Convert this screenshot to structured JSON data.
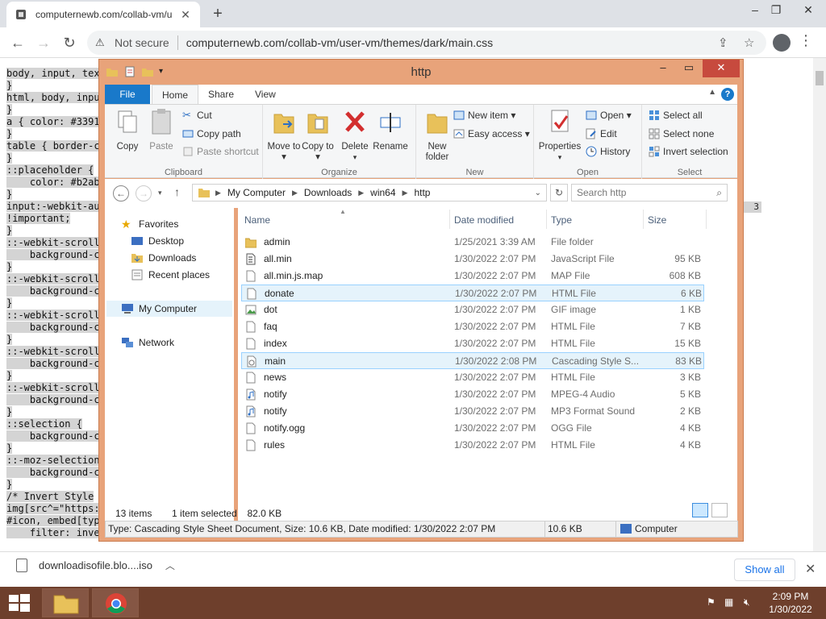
{
  "browser": {
    "tab_title": "computernewb.com/collab-vm/u",
    "tab_close": "✕",
    "new_tab": "+",
    "url_security": "Not secure",
    "url": "computernewb.com/collab-vm/user-vm/themes/dark/main.css",
    "minimize": "–",
    "restore": "❐",
    "close": "✕"
  },
  "page_text_lines": [
    "body, input, tex",
    "}",
    "html, body, inpu",
    "}",
    "a { color: #3391",
    "}",
    "table { border-c",
    "}",
    "::placeholder {",
    "    color: #b2ab",
    "}",
    "input:-webkit-au",
    "!important;",
    "}",
    "::-webkit-scroll",
    "    background-c",
    "}",
    "::-webkit-scroll",
    "    background-c",
    "}",
    "::-webkit-scroll",
    "    background-c",
    "}",
    "::-webkit-scroll",
    "    background-c",
    "}",
    "::-webkit-scroll",
    "    background-c",
    "}",
    "::selection {",
    "    background-c",
    "}",
    "::-moz-selection",
    "    background-c",
    "}",
    "/* Invert Style",
    "img[src^=\"https:",
    "#icon, embed[typ",
    "    filter: inve"
  ],
  "page_stray": "3",
  "explorer": {
    "title": "http",
    "tabs": [
      "File",
      "Home",
      "Share",
      "View"
    ],
    "help": "?",
    "ribbon": {
      "clipboard": {
        "name": "Clipboard",
        "copy": "Copy",
        "paste": "Paste",
        "cut": "Cut",
        "copy_path": "Copy path",
        "paste_shortcut": "Paste shortcut"
      },
      "organize": {
        "name": "Organize",
        "move_to": "Move to ▾",
        "copy_to": "Copy to ▾",
        "delete": "Delete",
        "delete_arrow": "▾",
        "rename": "Rename"
      },
      "new": {
        "name": "New",
        "new_folder": "New folder",
        "new_item": "New item ▾",
        "easy_access": "Easy access ▾"
      },
      "open": {
        "name": "Open",
        "properties": "Properties",
        "properties_arrow": "▾",
        "open": "Open ▾",
        "edit": "Edit",
        "history": "History"
      },
      "select": {
        "name": "Select",
        "select_all": "Select all",
        "select_none": "Select none",
        "invert": "Invert selection"
      }
    },
    "address": {
      "crumbs": [
        "My Computer",
        "Downloads",
        "win64",
        "http"
      ],
      "search_placeholder": "Search http"
    },
    "nav": {
      "favorites": "Favorites",
      "desktop": "Desktop",
      "downloads": "Downloads",
      "recent": "Recent places",
      "computer": "My Computer",
      "network": "Network"
    },
    "columns": [
      "Name",
      "Date modified",
      "Type",
      "Size"
    ],
    "files": [
      {
        "name": "admin",
        "date": "1/25/2021 3:39 AM",
        "type": "File folder",
        "size": "",
        "icon": "folder"
      },
      {
        "name": "all.min",
        "date": "1/30/2022 2:07 PM",
        "type": "JavaScript File",
        "size": "95 KB",
        "icon": "script"
      },
      {
        "name": "all.min.js.map",
        "date": "1/30/2022 2:07 PM",
        "type": "MAP File",
        "size": "608 KB",
        "icon": "doc"
      },
      {
        "name": "donate",
        "date": "1/30/2022 2:07 PM",
        "type": "HTML File",
        "size": "6 KB",
        "icon": "doc"
      },
      {
        "name": "dot",
        "date": "1/30/2022 2:07 PM",
        "type": "GIF image",
        "size": "1 KB",
        "icon": "image"
      },
      {
        "name": "faq",
        "date": "1/30/2022 2:07 PM",
        "type": "HTML File",
        "size": "7 KB",
        "icon": "doc"
      },
      {
        "name": "index",
        "date": "1/30/2022 2:07 PM",
        "type": "HTML File",
        "size": "15 KB",
        "icon": "doc"
      },
      {
        "name": "main",
        "date": "1/30/2022 2:08 PM",
        "type": "Cascading Style S...",
        "size": "83 KB",
        "icon": "css"
      },
      {
        "name": "news",
        "date": "1/30/2022 2:07 PM",
        "type": "HTML File",
        "size": "3 KB",
        "icon": "doc"
      },
      {
        "name": "notify",
        "date": "1/30/2022 2:07 PM",
        "type": "MPEG-4 Audio",
        "size": "5 KB",
        "icon": "audio"
      },
      {
        "name": "notify",
        "date": "1/30/2022 2:07 PM",
        "type": "MP3 Format Sound",
        "size": "2 KB",
        "icon": "audio"
      },
      {
        "name": "notify.ogg",
        "date": "1/30/2022 2:07 PM",
        "type": "OGG File",
        "size": "4 KB",
        "icon": "doc"
      },
      {
        "name": "rules",
        "date": "1/30/2022 2:07 PM",
        "type": "HTML File",
        "size": "4 KB",
        "icon": "doc"
      }
    ],
    "status": {
      "count": "13 items",
      "selected": "1 item selected",
      "selected_size": "82.0 KB"
    },
    "detail": {
      "info": "Type: Cascading Style Sheet Document, Size: 10.6 KB, Date modified: 1/30/2022 2:07 PM",
      "size": "10.6 KB",
      "location": "Computer"
    }
  },
  "download_shelf": {
    "filename": "downloadisofile.blo....iso",
    "show_all": "Show all",
    "close": "✕"
  },
  "taskbar": {
    "time": "2:09 PM",
    "date": "1/30/2022"
  },
  "colors": {
    "accent": "#1979ca",
    "window_frame": "#e8a37a",
    "taskbar": "#6e3f2c",
    "close_red": "#c74a3e"
  }
}
